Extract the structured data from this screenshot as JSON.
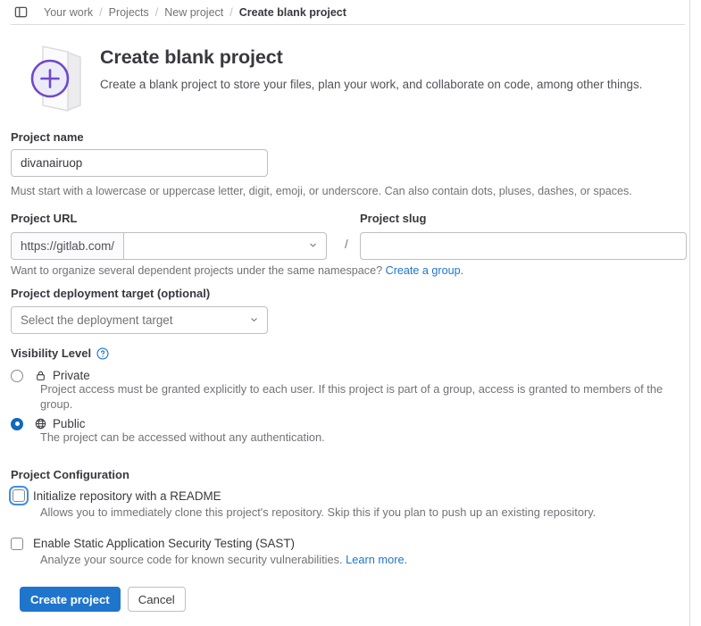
{
  "breadcrumb": {
    "toggle_icon": "sidebar-toggle-icon",
    "items": [
      {
        "label": "Your work",
        "current": false
      },
      {
        "label": "Projects",
        "current": false
      },
      {
        "label": "New project",
        "current": false
      },
      {
        "label": "Create blank project",
        "current": true
      }
    ],
    "separator": "/"
  },
  "header": {
    "icon": "new-project-plus-icon",
    "title": "Create blank project",
    "description": "Create a blank project to store your files, plan your work, and collaborate on code, among other things."
  },
  "form": {
    "project_name": {
      "label": "Project name",
      "value": "divanairuop",
      "placeholder": "",
      "hint": "Must start with a lowercase or uppercase letter, digit, emoji, or underscore. Can also contain dots, pluses, dashes, or spaces."
    },
    "project_url": {
      "label": "Project URL",
      "prefix": "https://gitlab.com/",
      "namespace_value": "",
      "chevron_icon": "chevron-down-icon"
    },
    "project_slug": {
      "label": "Project slug",
      "value": "",
      "placeholder": ""
    },
    "url_separator": "/",
    "namespace_hint": {
      "text": "Want to organize several dependent projects under the same namespace?",
      "link_label": "Create a group."
    },
    "deployment_target": {
      "label": "Project deployment target (optional)",
      "selected": "Select the deployment target",
      "chevron_icon": "chevron-down-icon"
    },
    "visibility": {
      "label": "Visibility Level",
      "help_icon": "question-circle-icon",
      "options": [
        {
          "name": "Private",
          "icon": "lock-icon",
          "selected": false,
          "description": "Project access must be granted explicitly to each user. If this project is part of a group, access is granted to members of the group."
        },
        {
          "name": "Public",
          "icon": "globe-icon",
          "selected": true,
          "description": "The project can be accessed without any authentication."
        }
      ]
    },
    "configuration": {
      "label": "Project Configuration",
      "options": [
        {
          "label": "Initialize repository with a README",
          "checked": false,
          "focused": true,
          "description": "Allows you to immediately clone this project's repository. Skip this if you plan to push up an existing repository.",
          "link_label": ""
        },
        {
          "label": "Enable Static Application Security Testing (SAST)",
          "checked": false,
          "focused": false,
          "description": "Analyze your source code for known security vulnerabilities.",
          "link_label": "Learn more."
        }
      ]
    },
    "actions": {
      "submit_label": "Create project",
      "cancel_label": "Cancel"
    }
  },
  "colors": {
    "primary_blue": "#1f75cb",
    "link_blue": "#1f75cb",
    "radio_blue": "#1068bf",
    "focus_blue": "#428fdc",
    "accent_purple": "#6e49cb",
    "text": "#3a383f",
    "muted_text": "#737278",
    "border": "#bfbfc3"
  }
}
